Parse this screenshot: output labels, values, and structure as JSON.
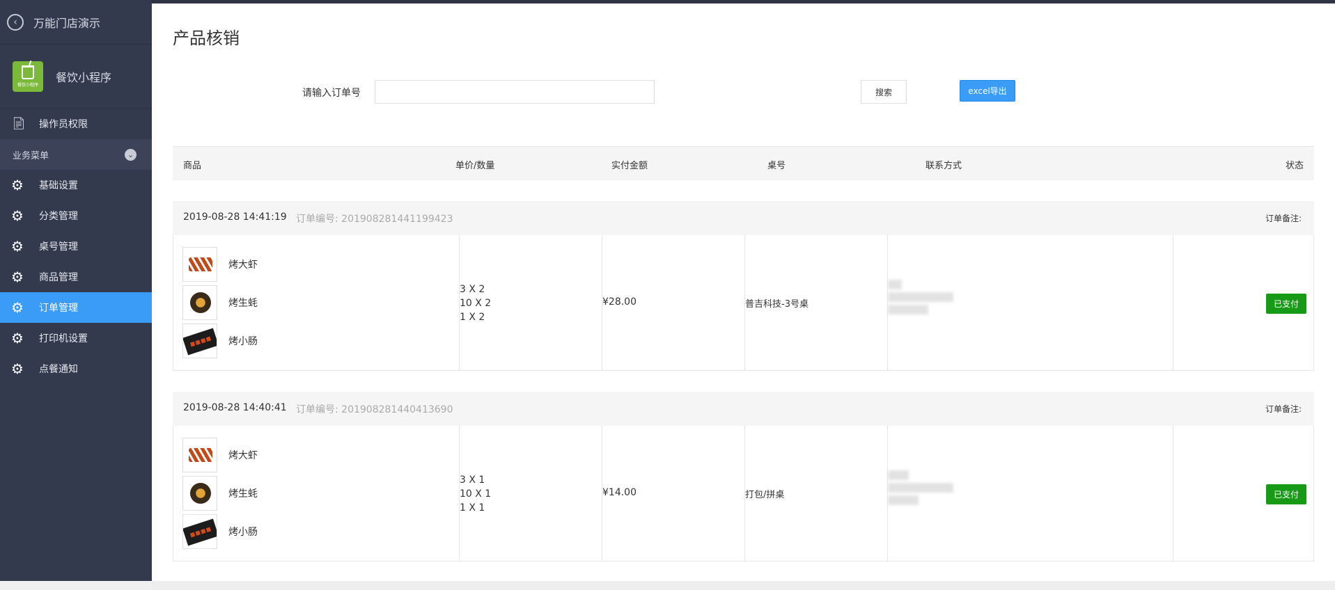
{
  "sidebar": {
    "back_label": "万能门店演示",
    "brand_name": "餐饮小程序",
    "brand_logo_text": "餐饮小程序",
    "operator_perm": "操作员权限",
    "section_label": "业务菜单",
    "items": [
      {
        "label": "基础设置",
        "icon": "gear-icon"
      },
      {
        "label": "分类管理",
        "icon": "gear-icon"
      },
      {
        "label": "桌号管理",
        "icon": "gear-icon"
      },
      {
        "label": "商品管理",
        "icon": "gear-icon"
      },
      {
        "label": "订单管理",
        "icon": "gear-icon",
        "active": true
      },
      {
        "label": "打印机设置",
        "icon": "gear-icon"
      },
      {
        "label": "点餐通知",
        "icon": "gear-icon"
      }
    ],
    "active_color": "#3b9cf7"
  },
  "page": {
    "title": "产品核销",
    "search_label": "请输入订单号",
    "search_value": "",
    "search_button": "搜索",
    "export_button": "excel导出"
  },
  "table": {
    "headers": [
      "商品",
      "单价/数量",
      "实付金额",
      "桌号",
      "联系方式",
      "状态"
    ]
  },
  "orders": [
    {
      "time": "2019-08-28 14:41:19",
      "order_no": "订单编号: 2019082814411994​23",
      "note_label": "订单备注:",
      "goods": [
        {
          "name": "烤大虾",
          "icon": "shrimp-thumb"
        },
        {
          "name": "烤生蚝",
          "icon": "oyster-thumb"
        },
        {
          "name": "烤小肠",
          "icon": "sausage-thumb"
        }
      ],
      "qty": [
        "3 X 2",
        "10 X 2",
        "1 X 2"
      ],
      "amount": "¥28.00",
      "table_no": "普吉科技-3号桌",
      "status": "已支付"
    },
    {
      "time": "2019-08-28 14:40:41",
      "order_no": "订单编号: 2019082814404136​90",
      "note_label": "订单备注:",
      "goods": [
        {
          "name": "烤大虾",
          "icon": "shrimp-thumb"
        },
        {
          "name": "烤生蚝",
          "icon": "oyster-thumb"
        },
        {
          "name": "烤小肠",
          "icon": "sausage-thumb"
        }
      ],
      "qty": [
        "3 X 1",
        "10 X 1",
        "1 X 1"
      ],
      "amount": "¥14.00",
      "table_no": "打包/拼桌",
      "status": "已支付"
    }
  ],
  "colors": {
    "paid_green": "#179b16",
    "sidebar_bg": "#343a4e"
  }
}
